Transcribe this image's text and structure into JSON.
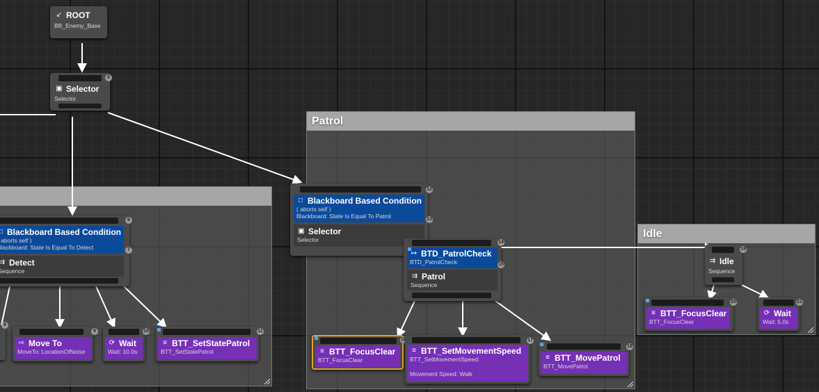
{
  "colors": {
    "decorator": "#0b4a9b",
    "task": "#7530b6",
    "comment_header": "#a6a6a6",
    "selected_outline": "#e5a22a"
  },
  "comments": {
    "detect_title": "",
    "patrol_title": "Patrol",
    "idle_title": "Idle"
  },
  "root": {
    "icon": "root-icon",
    "title": "ROOT",
    "blackboard": "BB_Enemy_Base"
  },
  "main_selector": {
    "title": "Selector",
    "subtitle": "Selector",
    "index": "0"
  },
  "detect_branch": {
    "decorator_title": "Blackboard Based Condition",
    "decorator_line1": "( aborts self )",
    "decorator_line2": "Blackboard: State Is Equal To Detect",
    "decorator_index": "6",
    "composite_index": "7",
    "composite_title": "Detect",
    "composite_subtitle": "Sequence",
    "left_index": "8",
    "move_to": {
      "title": "Move To",
      "subtitle": "MoveTo: LocationOfNoise",
      "index": "9"
    },
    "wait": {
      "title": "Wait",
      "subtitle": "Wait: 10.0s",
      "index": "10"
    },
    "set_state": {
      "title": "BTT_SetStatePatrol",
      "subtitle": "BTT_SetStatePatrol",
      "index": "11"
    }
  },
  "patrol_branch": {
    "decorator_title": "Blackboard Based Condition",
    "decorator_line1": "( aborts self )",
    "decorator_line2": "Blackboard: State Is Equal To Patrol",
    "decorator_index": "12",
    "composite_index": "13",
    "composite_title": "Selector",
    "composite_subtitle": "Selector",
    "check": {
      "title": "BTD_PatrolCheck",
      "subtitle": "BTD_PatrolCheck",
      "index": "14",
      "seq_index": "15"
    },
    "seq_title": "Patrol",
    "seq_subtitle": "Sequence",
    "focus": {
      "title": "BTT_FocusClear",
      "subtitle": "BTT_FocusClear",
      "index": "16"
    },
    "speed": {
      "title": "BTT_SetMovementSpeed",
      "subtitle": "BTT_SetMovementSpeed:",
      "detail": "Movement Speed: Walk",
      "index": "17"
    },
    "move": {
      "title": "BTT_MovePatrol",
      "subtitle": "BTT_MovePatrol",
      "index": "18"
    }
  },
  "idle_branch": {
    "title": "Idle",
    "subtitle": "Sequence",
    "index": "19",
    "focus": {
      "title": "BTT_FocusClear",
      "subtitle": "BTT_FocusClear",
      "index": "20"
    },
    "wait": {
      "title": "Wait",
      "subtitle": "Wait: 5.0s",
      "index": "21"
    }
  }
}
